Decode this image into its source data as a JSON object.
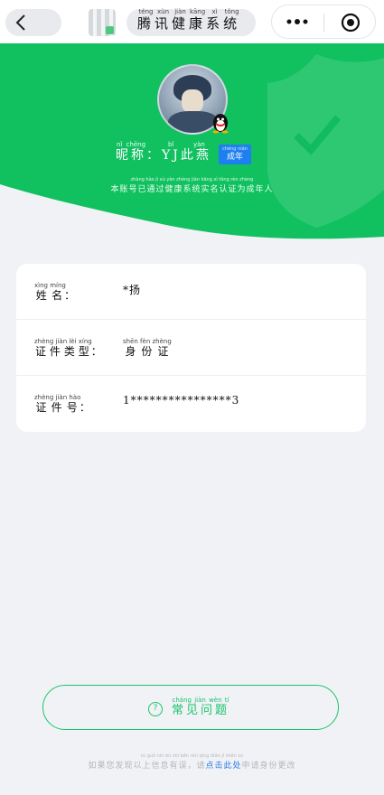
{
  "nav": {
    "title": "腾讯健康系统",
    "title_pinyin": [
      "téng",
      "xùn",
      "jiàn",
      "kāng",
      "xì",
      "tǒng"
    ]
  },
  "profile": {
    "nickname_label": "昵称",
    "nickname_label_pinyin": [
      "nǐ",
      "chēng"
    ],
    "nickname_sep": "：",
    "nickname_value": "YJ此燕",
    "nickname_value_pinyin": "bǐ yàn",
    "adult_badge_pinyin": "chéng nián",
    "adult_badge": "成年",
    "desc_pinyin": "zhàng hào jì xù yàn zhèng jiàn kāng xì tǒng rèn zhèng",
    "desc": "本账号已通过健康系统实名认证为成年人"
  },
  "info": {
    "rows": [
      {
        "label": "姓名",
        "label_pinyin": [
          "xìng",
          "míng"
        ],
        "colon": "：",
        "value": "*扬",
        "value_pinyin": [
          "",
          "yáng"
        ]
      },
      {
        "label": "证件类型",
        "label_pinyin": [
          "zhèng",
          "jiàn",
          "lèi",
          "xíng"
        ],
        "colon": "：",
        "value": "身份证",
        "value_pinyin": [
          "shēn",
          "fèn",
          "zhèng"
        ]
      },
      {
        "label": "证件号",
        "label_pinyin": [
          "zhèng",
          "jiàn",
          "hào"
        ],
        "colon": "：",
        "value": "1****************3",
        "value_pinyin": []
      }
    ]
  },
  "faq": {
    "icon_text": "?",
    "label": "常见问题",
    "label_pinyin": [
      "cháng",
      "jiàn",
      "wèn",
      "tí"
    ]
  },
  "footer": {
    "pinyin": "rú guǒ nín bù shì běn rén qǐng diǎn jī shēn sù",
    "text_before": "如果您发现以上信息有误，请",
    "link": "点击此处",
    "text_after": "申请身份更改"
  },
  "colors": {
    "green": "#11c160",
    "accent": "#18c46a",
    "badge_blue": "#1e7ff0"
  },
  "icons": [
    "back-arrow-icon",
    "more-dots-icon",
    "target-icon",
    "qq-penguin-icon",
    "question-circle-icon",
    "shield-watermark-icon"
  ]
}
